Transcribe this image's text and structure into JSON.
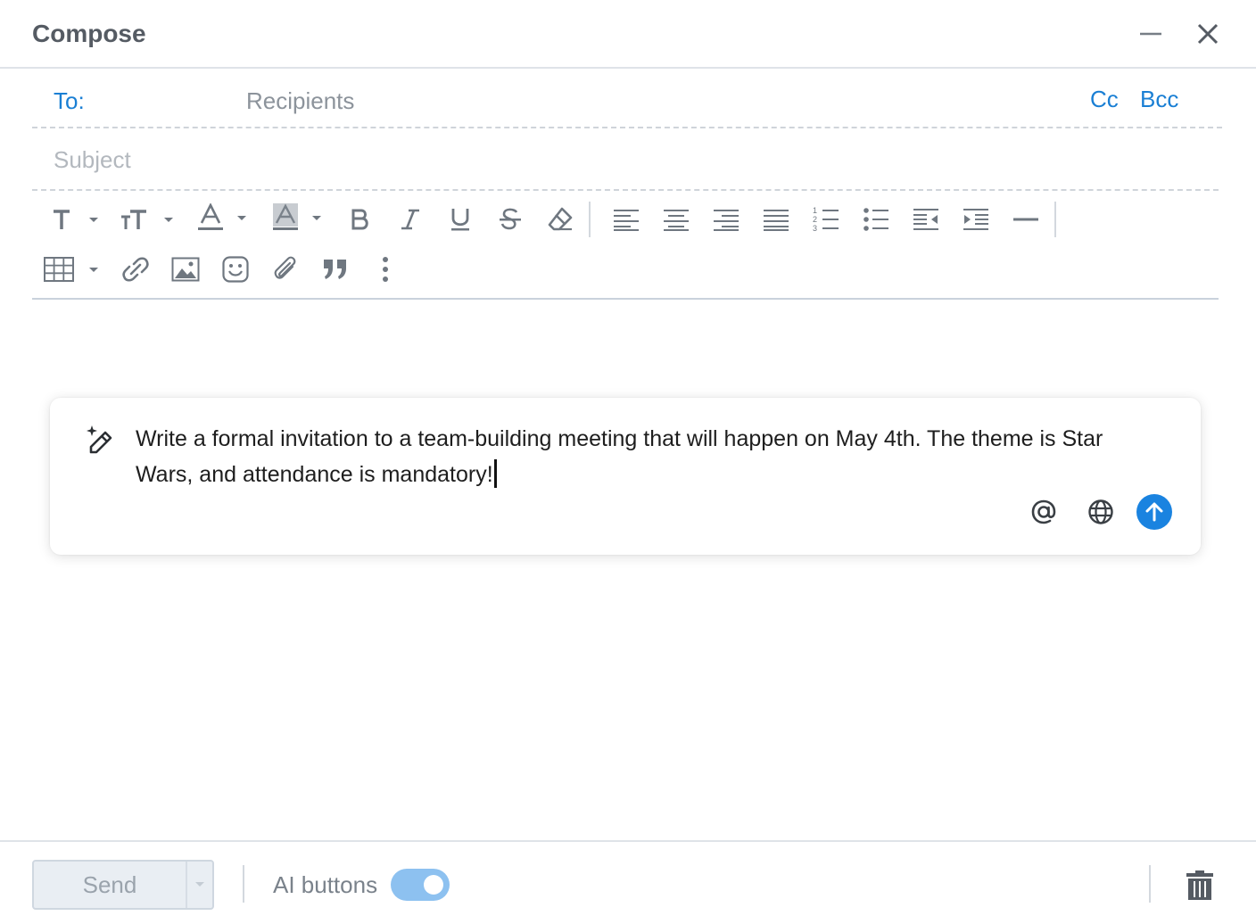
{
  "header": {
    "title": "Compose",
    "minimize_icon": "minimize-icon",
    "close_icon": "close-icon"
  },
  "recipients": {
    "to_label": "To:",
    "placeholder": "Recipients",
    "value": "",
    "cc_label": "Cc",
    "bcc_label": "Bcc"
  },
  "subject": {
    "placeholder": "Subject",
    "value": ""
  },
  "toolbar": {
    "row1": [
      "font-icon",
      "font-size-icon",
      "text-color-icon",
      "background-color-icon",
      "bold-icon",
      "italic-icon",
      "underline-icon",
      "strikethrough-icon",
      "clear-formatting-icon",
      "align-left-icon",
      "align-center-icon",
      "align-right-icon",
      "justify-icon",
      "numbered-list-icon",
      "bulleted-list-icon",
      "outdent-icon",
      "indent-icon",
      "horizontal-rule-icon"
    ],
    "row2": [
      "table-icon",
      "link-icon",
      "image-icon",
      "emoji-icon",
      "attachment-icon",
      "quote-icon",
      "more-icon"
    ]
  },
  "ai_prompt": {
    "text": "Write a formal invitation to a team-building meeting that will happen on May 4th. The theme is Star Wars, and attendance is mandatory!",
    "icons": [
      "magic-wand-icon",
      "at-icon",
      "globe-icon",
      "send-arrow-icon"
    ]
  },
  "footer": {
    "send_label": "Send",
    "ai_buttons_label": "AI buttons",
    "ai_buttons_enabled": true,
    "trash_icon": "trash-icon"
  },
  "colors": {
    "accent": "#1a7fd4",
    "send_button_blue": "#1a83e0",
    "toggle_on": "#8dc1f0",
    "icon_gray": "#6f7780"
  }
}
